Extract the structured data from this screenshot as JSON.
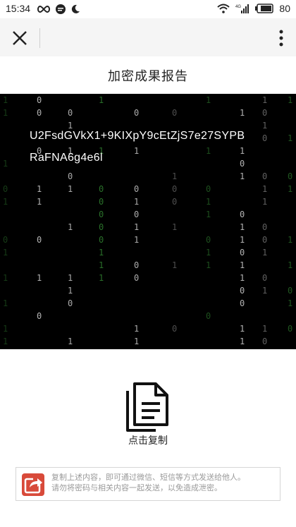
{
  "status_bar": {
    "time": "15:34",
    "network": "4G",
    "battery": "80"
  },
  "toolbar": {
    "close_icon": "close-icon",
    "more_icon": "more-vertical-icon"
  },
  "page": {
    "title": "加密成果报告"
  },
  "encrypted": {
    "line1": "U2FsdGVkX1+9KIXpY9cEtZjS7e27SYPB",
    "line2": "RaFNA6g4e6l"
  },
  "copy": {
    "icon": "copy-document-icon",
    "label": "点击复制"
  },
  "notice": {
    "icon": "share-icon",
    "line1": "复制上述内容，即可通过微信、短信等方式发送给他人。",
    "line2": "请勿将密码与相关内容一起发送，以免造成泄密。"
  },
  "colors": {
    "accent_red": "#d84a3a",
    "matrix_green": "#3a9a3a",
    "matrix_white": "#dcdcdc"
  }
}
